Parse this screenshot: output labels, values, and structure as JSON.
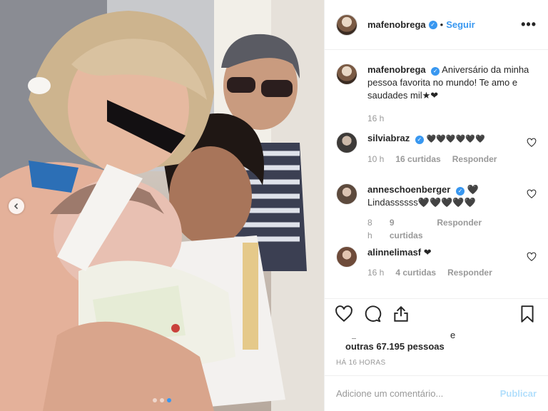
{
  "post": {
    "author": "mafenobrega",
    "follow_label": "Seguir",
    "separator": "•",
    "more_label": "•••"
  },
  "caption": {
    "user": "mafenobrega",
    "text": "Aniversário da minha pessoa favorita no mundo! Te amo e saudades mil★❤",
    "time": "16 h"
  },
  "comments": [
    {
      "user": "silviabraz",
      "text": "🖤🖤🖤🖤🖤🖤",
      "time": "10 h",
      "likes": "16 curtidas",
      "reply": "Responder"
    },
    {
      "user": "anneschoenberger",
      "text": "🖤 Lindassssss🖤🖤🖤🖤🖤",
      "time": "8 h",
      "likes": "9 curtidas",
      "reply": "Responder"
    },
    {
      "user": "alinnelimasf",
      "text": "❤",
      "time": "16 h",
      "likes": "4 curtidas",
      "reply": "Responder"
    }
  ],
  "likes": {
    "connector": "e",
    "count_text": "outras 67.195 pessoas"
  },
  "timestamp": "HÁ 16 HORAS",
  "comment_box": {
    "placeholder": "Adicione um comentário...",
    "publish_label": "Publicar"
  },
  "carousel": {
    "count": 3,
    "active": 3
  },
  "colors": {
    "accent": "#3897f0",
    "publish_disabled": "#b2dffc",
    "meta": "#999999"
  }
}
